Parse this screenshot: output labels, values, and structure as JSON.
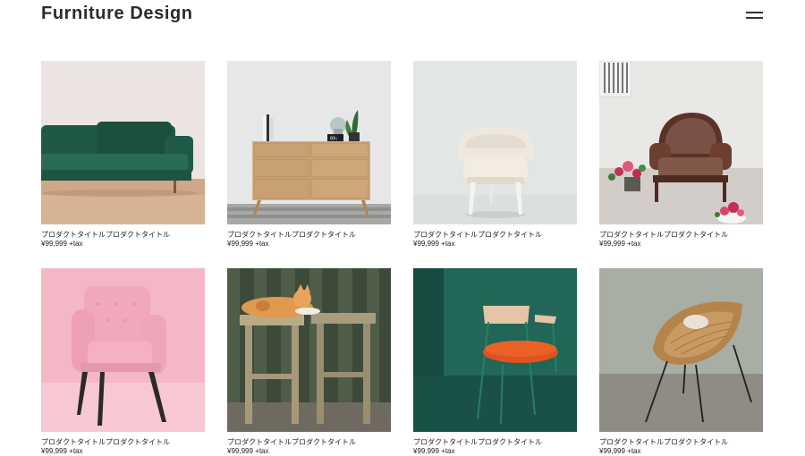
{
  "header": {
    "title": "Furniture Design",
    "menu_icon": "hamburger-menu-icon"
  },
  "products": [
    {
      "name": "プロダクトタイトルプロダクトタイトル",
      "price": "¥99,999 +tax",
      "image": "green-velvet-sofa"
    },
    {
      "name": "プロダクトタイトルプロダクトタイトル",
      "price": "¥99,999 +tax",
      "image": "wooden-chest-of-drawers"
    },
    {
      "name": "プロダクトタイトルプロダクトタイトル",
      "price": "¥99,999 +tax",
      "image": "white-tufted-armchair"
    },
    {
      "name": "プロダクトタイトルプロダクトタイトル",
      "price": "¥99,999 +tax",
      "image": "brown-vintage-armchair"
    },
    {
      "name": "プロダクトタイトルプロダクトタイトル",
      "price": "¥99,999 +tax",
      "image": "pink-armchair"
    },
    {
      "name": "プロダクトタイトルプロダクトタイトル",
      "price": "¥99,999 +tax",
      "image": "wooden-stools-with-cat"
    },
    {
      "name": "プロダクトタイトルプロダクトタイトル",
      "price": "¥99,999 +tax",
      "image": "orange-seat-chair"
    },
    {
      "name": "プロダクトタイトルプロダクトタイトル",
      "price": "¥99,999 +tax",
      "image": "rattan-chair"
    }
  ]
}
